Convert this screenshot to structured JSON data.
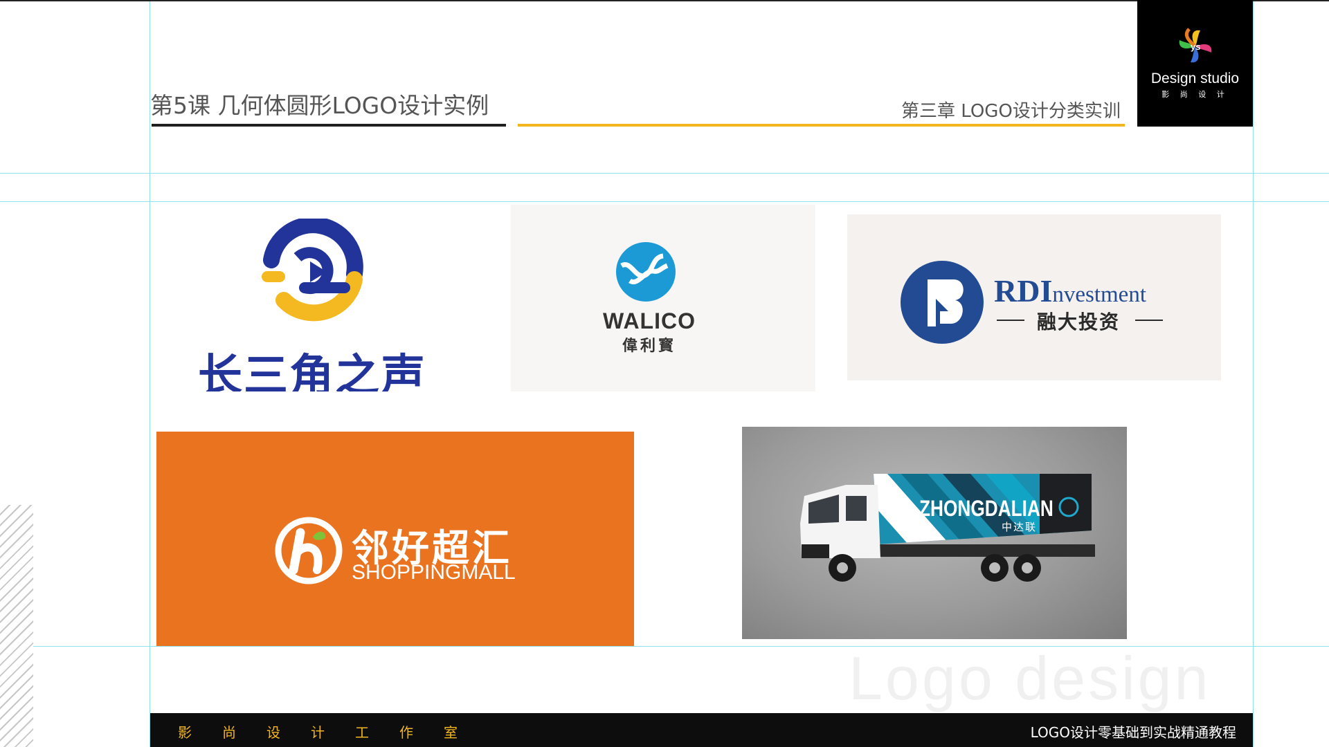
{
  "header": {
    "lesson_title": "第5课 几何体圆形LOGO设计实例",
    "chapter_title": "第三章 LOGO设计分类实训",
    "accent_color": "#f3b61f"
  },
  "studio": {
    "logo_text": "ys",
    "name": "Design studio",
    "subtitle": "影 尚 设 计"
  },
  "logos": {
    "changsanjiao": {
      "text": "长三角之声",
      "icon": "play-speech-bubble-icon",
      "colors": [
        "#22349a",
        "#f4b920"
      ]
    },
    "walico": {
      "name": "WALICO",
      "cn_name": "偉利寳",
      "icon": "blue-circle-waves-icon",
      "color": "#1c9ad6"
    },
    "rdi": {
      "name_big": "RDI",
      "name_small": "nvestment",
      "cn_name": "融大投资",
      "icon": "circle-b-icon",
      "color": "#234b93"
    },
    "shoppingmall": {
      "cn_name": "邻好超汇",
      "en_name": "SHOPPINGMALL",
      "icon": "h-leaf-circle-icon",
      "bg_color": "#ea7320"
    },
    "zhongdalian": {
      "name": "ZHONGDALIAN",
      "cn_name": "中达联",
      "icon": "truck-icon"
    }
  },
  "watermark": "Logo design",
  "footer": {
    "studio_chars": [
      "影",
      "尚",
      "设",
      "计",
      "工",
      "作",
      "室"
    ],
    "course_title": "LOGO设计零基础到实战精通教程"
  }
}
